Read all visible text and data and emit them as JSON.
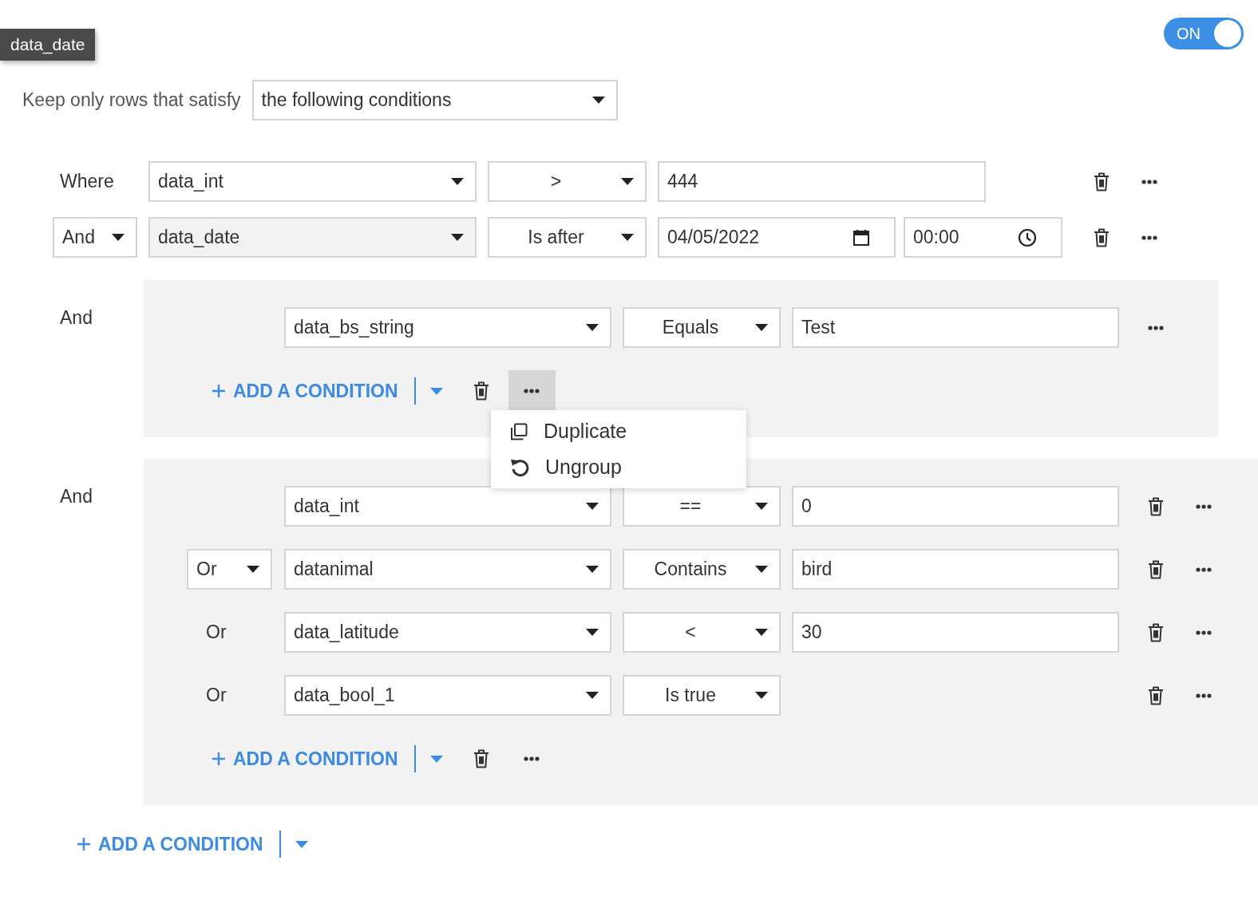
{
  "tooltip": {
    "text": "data_date"
  },
  "toggle": {
    "label": "ON",
    "on": true
  },
  "keep": {
    "label": "Keep only rows that satisfy",
    "mode": "the following conditions"
  },
  "conditions": [
    {
      "kind": "condition",
      "conjunction": {
        "kind": "label",
        "text": "Where"
      },
      "column": "data_int",
      "operator": ">",
      "value": "444",
      "deletable": true
    },
    {
      "kind": "condition",
      "conjunction": {
        "kind": "dropdown",
        "text": "And"
      },
      "column": "data_date",
      "column_hovered": true,
      "operator": "Is after",
      "date": "04/05/2022",
      "time": "00:00",
      "deletable": true
    },
    {
      "kind": "group",
      "conjunction": {
        "kind": "label",
        "text": "And"
      },
      "more_active": true,
      "add_label": "ADD A CONDITION",
      "menu": [
        {
          "kind": "duplicate",
          "label": "Duplicate"
        },
        {
          "kind": "ungroup",
          "label": "Ungroup"
        }
      ],
      "conditions": [
        {
          "kind": "condition",
          "column": "data_bs_string",
          "operator": "Equals",
          "value": "Test",
          "deletable": false
        }
      ]
    },
    {
      "kind": "group",
      "conjunction": {
        "kind": "label",
        "text": "And"
      },
      "more_active": false,
      "add_label": "ADD A CONDITION",
      "conditions": [
        {
          "kind": "condition",
          "column": "data_int",
          "operator": "==",
          "value": "0",
          "deletable": true
        },
        {
          "kind": "condition",
          "conjunction": {
            "kind": "dropdown",
            "text": "Or"
          },
          "column": "datanimal",
          "operator": "Contains",
          "value": "bird",
          "deletable": true
        },
        {
          "kind": "condition",
          "conjunction": {
            "kind": "label",
            "text": "Or"
          },
          "column": "data_latitude",
          "operator": "<",
          "value": "30",
          "deletable": true
        },
        {
          "kind": "condition",
          "conjunction": {
            "kind": "label",
            "text": "Or"
          },
          "column": "data_bool_1",
          "operator": "Is true",
          "deletable": true
        }
      ]
    }
  ],
  "add_label": "ADD A CONDITION"
}
